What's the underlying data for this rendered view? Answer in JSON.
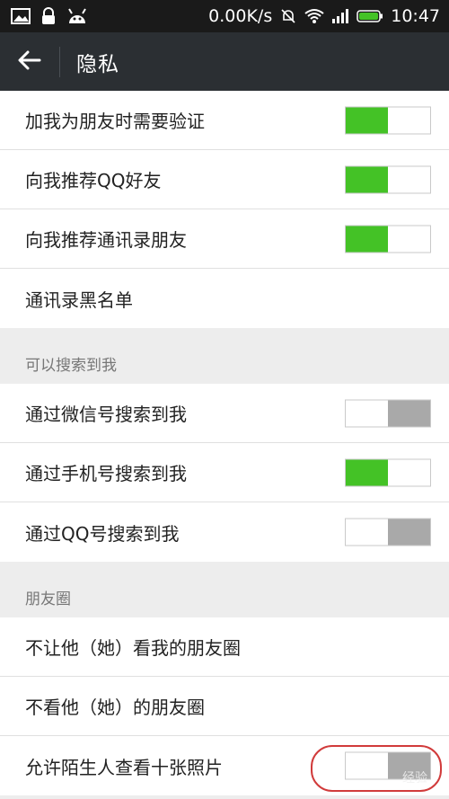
{
  "status_bar": {
    "net_speed": "0.00K/s",
    "time": "10:47"
  },
  "header": {
    "title": "隐私"
  },
  "group1": [
    {
      "label": "加我为朋友时需要验证",
      "toggle": "on"
    },
    {
      "label": "向我推荐QQ好友",
      "toggle": "on"
    },
    {
      "label": "向我推荐通讯录朋友",
      "toggle": "on"
    },
    {
      "label": "通讯录黑名单",
      "toggle": null
    }
  ],
  "search_section": {
    "title": "可以搜索到我",
    "items": [
      {
        "label": "通过微信号搜索到我",
        "toggle": "off"
      },
      {
        "label": "通过手机号搜索到我",
        "toggle": "on"
      },
      {
        "label": "通过QQ号搜索到我",
        "toggle": "off"
      }
    ]
  },
  "moments_section": {
    "title": "朋友圈",
    "items": [
      {
        "label": "不让他（她）看我的朋友圈",
        "toggle": null
      },
      {
        "label": "不看他（她）的朋友圈",
        "toggle": null
      },
      {
        "label": "允许陌生人查看十张照片",
        "toggle": "off"
      }
    ]
  },
  "watermark": "经验",
  "colors": {
    "toggle_on": "#44c226",
    "toggle_off": "#a9a9a9",
    "titlebar": "#2b2f33",
    "highlight_circle": "#d13b3b"
  }
}
